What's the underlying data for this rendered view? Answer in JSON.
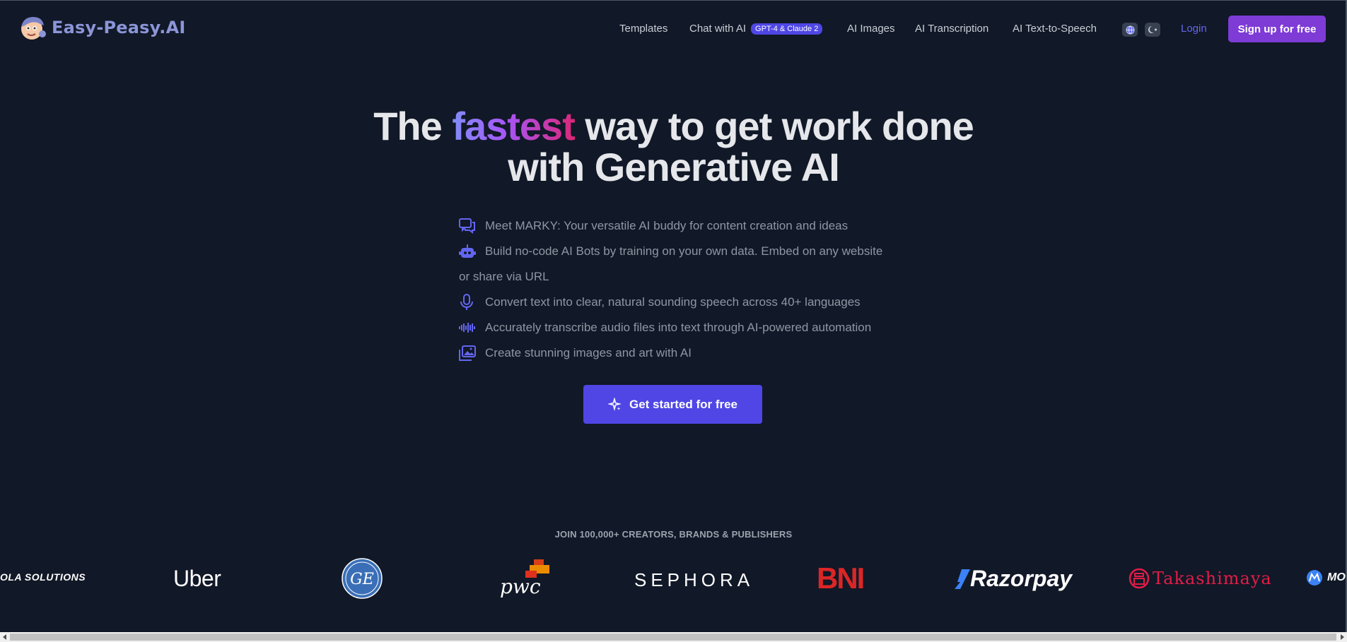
{
  "header": {
    "logo_text": "Easy-Peasy.AI",
    "nav": {
      "templates": "Templates",
      "chat": "Chat with AI",
      "chat_badge": "GPT-4 & Claude 2",
      "images": "AI Images",
      "transcription": "AI Transcription",
      "tts": "AI Text-to-Speech"
    },
    "login": "Login",
    "signup": "Sign up for free"
  },
  "hero": {
    "title_before": "The",
    "title_highlight": "fastest",
    "title_after": "way to get work done",
    "title_line2": "with Generative AI",
    "features": [
      {
        "icon": "chat-bubbles-icon",
        "text": "Meet MARKY: Your versatile AI buddy for content creation and ideas"
      },
      {
        "icon": "robot-icon",
        "text": "Build no-code AI Bots by training on your own data. Embed on any website or share via URL"
      },
      {
        "icon": "microphone-icon",
        "text": "Convert text into clear, natural sounding speech across 40+ languages"
      },
      {
        "icon": "waveform-icon",
        "text": "Accurately transcribe audio files into text through AI-powered automation"
      },
      {
        "icon": "images-icon",
        "text": "Create stunning images and art with AI"
      }
    ],
    "cta": "Get started for free"
  },
  "brands": {
    "heading": "JOIN 100,000+ CREATORS, BRANDS & PUBLISHERS",
    "logos": [
      "OLA SOLUTIONS",
      "Uber",
      "GE",
      "pwc",
      "SEPHORA",
      "BNI",
      "Razorpay",
      "Takashimaya",
      "MO"
    ]
  },
  "colors": {
    "background": "#111827",
    "accent": "#4f46e5",
    "signup": "#7e3bd6",
    "bni_red": "#dc2626"
  }
}
